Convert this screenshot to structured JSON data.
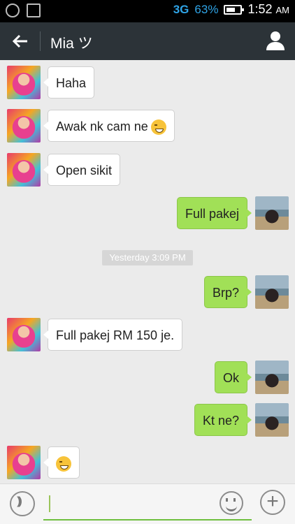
{
  "status_bar": {
    "network": "3G",
    "battery_percent": "63%",
    "time": "1:52",
    "ampm": "AM"
  },
  "header": {
    "back_icon": "arrow-left-icon",
    "contact_name": "Mia ツ",
    "profile_icon": "person-icon"
  },
  "messages": [
    {
      "direction": "in",
      "text": "Haha",
      "emoji": false
    },
    {
      "direction": "in",
      "text": "Awak nk cam ne",
      "emoji": true
    },
    {
      "direction": "in",
      "text": "Open sikit",
      "emoji": false
    },
    {
      "direction": "out",
      "text": "Full pakej",
      "emoji": false
    },
    {
      "direction": "out",
      "text": "Brp?",
      "emoji": false
    },
    {
      "direction": "in",
      "text": "Full pakej RM 150 je.",
      "emoji": false
    },
    {
      "direction": "out",
      "text": "Ok",
      "emoji": false
    },
    {
      "direction": "out",
      "text": "Kt ne?",
      "emoji": false
    },
    {
      "direction": "in",
      "text": "",
      "emoji": true
    }
  ],
  "timestamp": "Yesterday 3:09 PM",
  "input_bar": {
    "text_value": "",
    "voice_icon": "voice-icon",
    "emoji_icon": "smiley-icon",
    "attach_icon": "plus-icon"
  },
  "colors": {
    "header_bg": "#2c3338",
    "outgoing_bubble": "#a1e057",
    "incoming_bubble": "#ffffff",
    "chat_bg": "#ebebeb"
  }
}
